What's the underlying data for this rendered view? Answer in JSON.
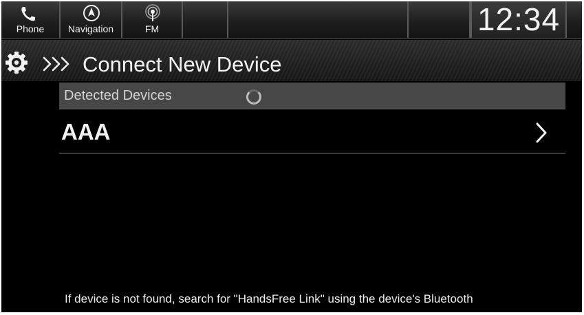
{
  "sources": [
    {
      "label": "Phone",
      "icon": "phone-icon"
    },
    {
      "label": "Navigation",
      "icon": "navigation-icon"
    },
    {
      "label": "FM",
      "icon": "radio-antenna-icon"
    }
  ],
  "clock": "12:34",
  "page": {
    "title": "Connect New Device",
    "icons": [
      "settings-gear-icon",
      "triple-chevron-icon"
    ]
  },
  "detected": {
    "header": "Detected Devices",
    "status_icon": "loading-spinner-icon",
    "devices": [
      {
        "name": "AAA",
        "icon": "chevron-right-icon"
      }
    ]
  },
  "footer": {
    "hint": "If device is not found, search for \"HandsFree Link\" using the device's Bluetooth"
  },
  "colors": {
    "background": "#000000",
    "header_bar": "#474747",
    "text": "#f2f2f2"
  }
}
